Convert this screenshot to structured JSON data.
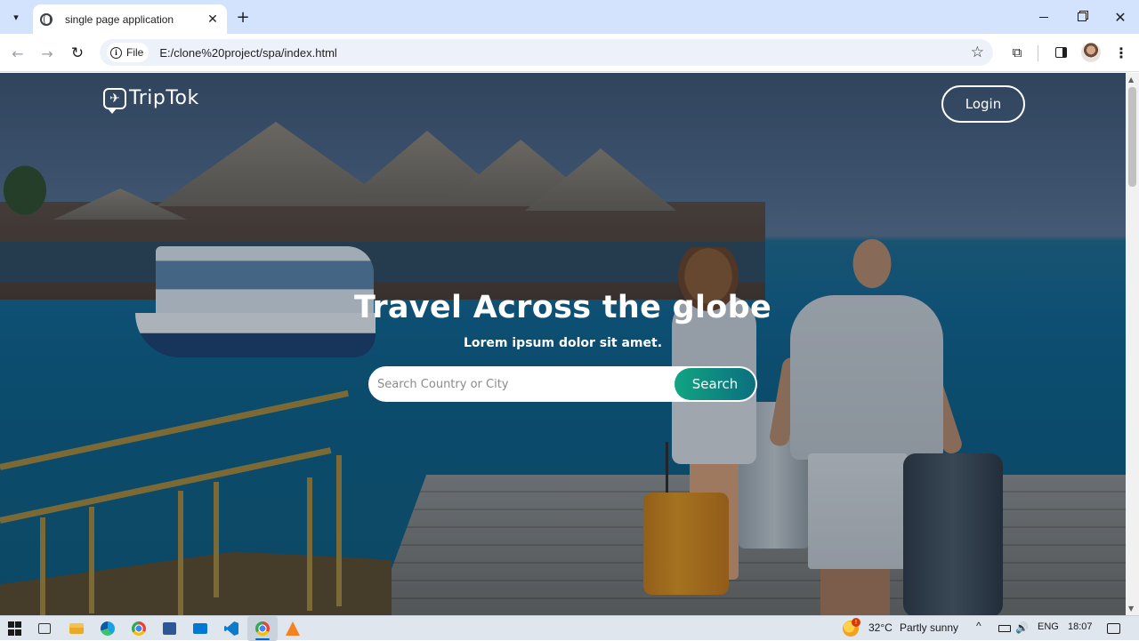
{
  "browser": {
    "tab_title": "single page application",
    "tab_close_glyph": "✕",
    "new_tab_glyph": "+",
    "tab_search_glyph": "▾",
    "site_chip_label": "File",
    "url": "E:/clone%20project/spa/index.html",
    "back_glyph": "←",
    "forward_glyph": "→",
    "reload_glyph": "↻",
    "star_glyph": "☆",
    "extensions_glyph": "⧉",
    "menu_glyph": "⋮",
    "close_glyph": "✕"
  },
  "site": {
    "logo_text": "TripTok",
    "logo_glyph": "✈",
    "login_label": "Login",
    "hero_title": "Travel Across the globe",
    "hero_subtitle": "Lorem ipsum dolor sit amet.",
    "search_placeholder": "Search Country or City",
    "search_value": "",
    "search_button_label": "Search",
    "accent_gradient": [
      "#11a583",
      "#0b6f7e"
    ]
  },
  "scrollbar": {
    "up_glyph": "▲",
    "down_glyph": "▼"
  },
  "taskbar": {
    "weather_badge": "!",
    "weather_temp": "32°C",
    "weather_desc": "Partly sunny",
    "tray_chevron_glyph": "^",
    "volume_glyph": "🔊",
    "language": "ENG",
    "time": "18:07",
    "icons": [
      "windows-start",
      "task-view",
      "file-explorer",
      "edge",
      "chrome",
      "store",
      "mail",
      "vscode",
      "chrome-active",
      "vlc",
      "weather",
      "battery",
      "volume",
      "notifications"
    ]
  }
}
